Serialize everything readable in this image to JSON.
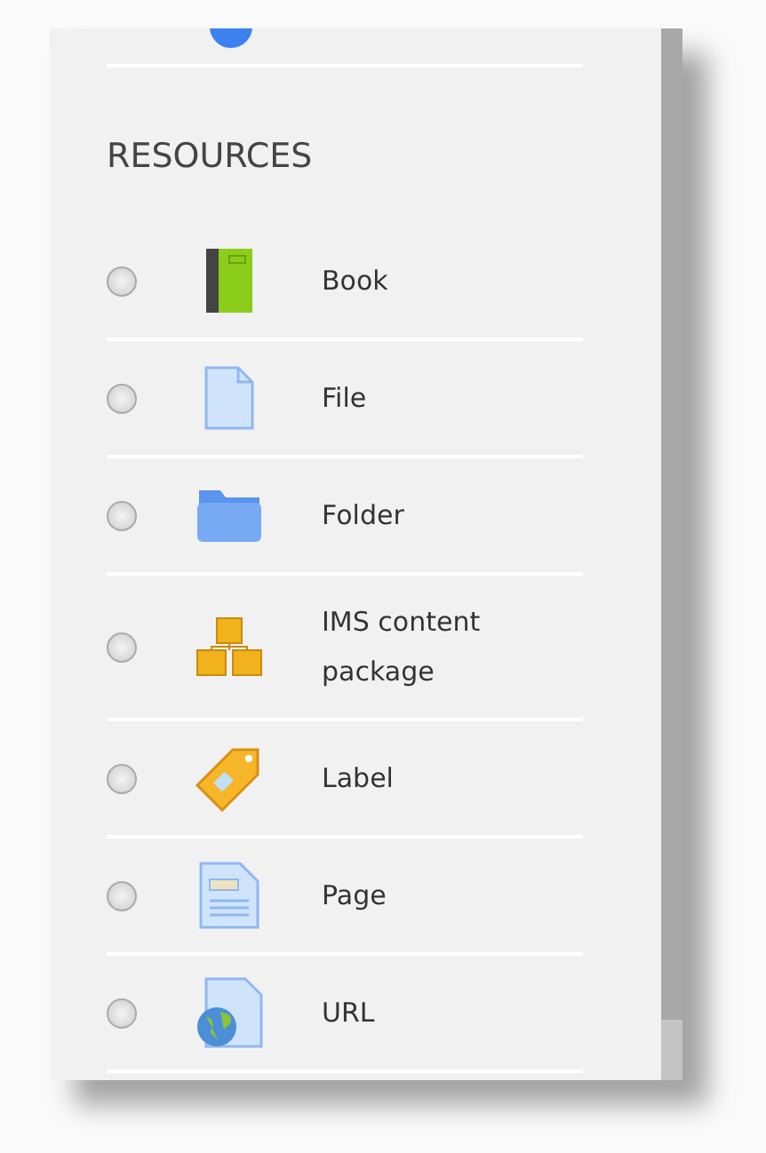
{
  "section": {
    "heading": "RESOURCES"
  },
  "items": [
    {
      "label": "Book",
      "kind": "book",
      "selected": false
    },
    {
      "label": "File",
      "kind": "file",
      "selected": false
    },
    {
      "label": "Folder",
      "kind": "folder",
      "selected": false
    },
    {
      "label": "IMS content package",
      "kind": "package",
      "selected": false
    },
    {
      "label": "Label",
      "kind": "label",
      "selected": false
    },
    {
      "label": "Page",
      "kind": "page",
      "selected": false
    },
    {
      "label": "URL",
      "kind": "url",
      "selected": false
    }
  ]
}
